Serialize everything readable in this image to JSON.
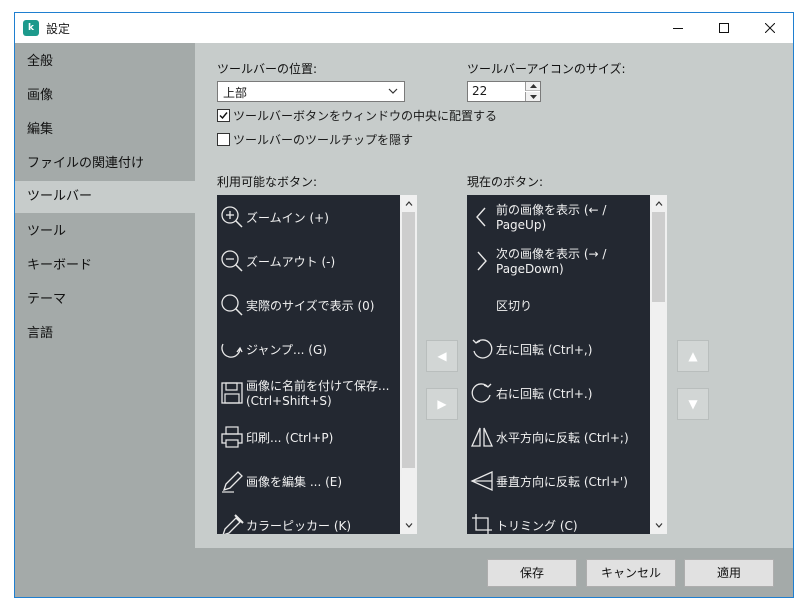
{
  "window": {
    "title": "設定",
    "app_icon_letter": "k"
  },
  "sidebar": {
    "items": [
      {
        "label": "全般"
      },
      {
        "label": "画像"
      },
      {
        "label": "編集"
      },
      {
        "label": "ファイルの関連付け"
      },
      {
        "label": "ツールバー",
        "active": true
      },
      {
        "label": "ツール"
      },
      {
        "label": "キーボード"
      },
      {
        "label": "テーマ"
      },
      {
        "label": "言語"
      }
    ]
  },
  "toolbar_settings": {
    "position_label": "ツールバーの位置:",
    "position_value": "上部",
    "icon_size_label": "ツールバーアイコンのサイズ:",
    "icon_size_value": "22",
    "center_buttons": {
      "label": "ツールバーボタンをウィンドウの中央に配置する",
      "checked": true
    },
    "hide_tooltips": {
      "label": "ツールバーのツールチップを隠す",
      "checked": false
    }
  },
  "available_buttons": {
    "label": "利用可能なボタン:",
    "items": [
      {
        "icon": "zoom-in-icon",
        "text": "ズームイン (+)"
      },
      {
        "icon": "zoom-out-icon",
        "text": "ズームアウト (-)"
      },
      {
        "icon": "actual-size-icon",
        "text": "実際のサイズで表示 (0)"
      },
      {
        "icon": "jump-icon",
        "text": "ジャンプ... (G)"
      },
      {
        "icon": "save-as-icon",
        "text": "画像に名前を付けて保存... (Ctrl+Shift+S)"
      },
      {
        "icon": "print-icon",
        "text": "印刷... (Ctrl+P)"
      },
      {
        "icon": "edit-image-icon",
        "text": "画像を編集 ... (E)"
      },
      {
        "icon": "color-picker-icon",
        "text": "カラーピッカー (K)"
      }
    ]
  },
  "current_buttons": {
    "label": "現在のボタン:",
    "items": [
      {
        "icon": "previous-image-icon",
        "text": "前の画像を表示 (← / PageUp)"
      },
      {
        "icon": "next-image-icon",
        "text": "次の画像を表示 (→ / PageDown)"
      },
      {
        "icon": "separator-icon",
        "text": "区切り"
      },
      {
        "icon": "rotate-left-icon",
        "text": "左に回転 (Ctrl+,)"
      },
      {
        "icon": "rotate-right-icon",
        "text": "右に回転 (Ctrl+.)"
      },
      {
        "icon": "flip-horizontal-icon",
        "text": "水平方向に反転 (Ctrl+;)"
      },
      {
        "icon": "flip-vertical-icon",
        "text": "垂直方向に反転 (Ctrl+')"
      },
      {
        "icon": "crop-icon",
        "text": "トリミング (C)"
      }
    ]
  },
  "move_buttons": {
    "add": "▶",
    "remove": "◀",
    "up": "▲",
    "down": "▼"
  },
  "footer": {
    "save_label": "保存",
    "cancel_label": "キャンセル",
    "apply_label": "適用"
  },
  "colors": {
    "accent": "#1f7fd0",
    "sidebar_bg": "#a4aaa9",
    "content_bg": "#c7cccb",
    "list_bg": "#232831"
  }
}
